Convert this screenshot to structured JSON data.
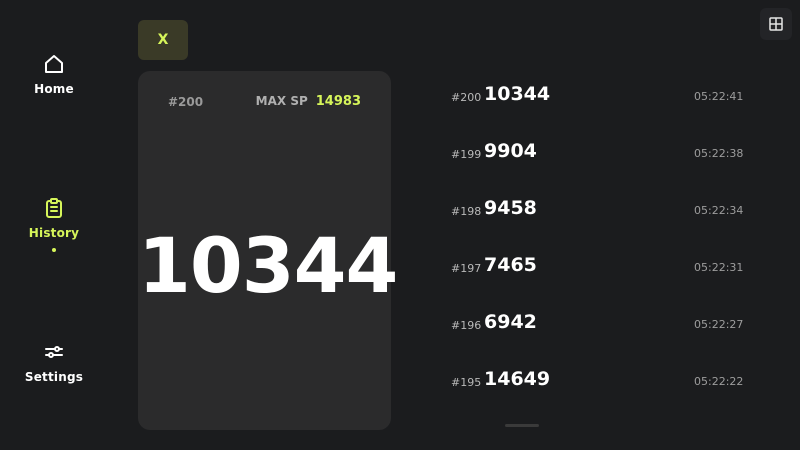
{
  "nav": {
    "items": [
      {
        "label": "Home",
        "icon": "home-icon",
        "active": false
      },
      {
        "label": "History",
        "icon": "clipboard-icon",
        "active": true
      },
      {
        "label": "Settings",
        "icon": "sliders-icon",
        "active": false
      }
    ]
  },
  "toolbar": {
    "close_label": "X",
    "grid_icon": "grid-icon"
  },
  "card": {
    "id": "#200",
    "max_label": "MAX SP",
    "max_value": "14983",
    "value": "10344"
  },
  "history": [
    {
      "id": "#200",
      "value": "10344",
      "time": "05:22:41"
    },
    {
      "id": "#199",
      "value": "9904",
      "time": "05:22:38"
    },
    {
      "id": "#198",
      "value": "9458",
      "time": "05:22:34"
    },
    {
      "id": "#197",
      "value": "7465",
      "time": "05:22:31"
    },
    {
      "id": "#196",
      "value": "6942",
      "time": "05:22:27"
    },
    {
      "id": "#195",
      "value": "14649",
      "time": "05:22:22"
    }
  ],
  "colors": {
    "background": "#1b1c1e",
    "card": "#2b2b2c",
    "accent": "#d6f55a",
    "close_bg": "#3a3a27"
  }
}
